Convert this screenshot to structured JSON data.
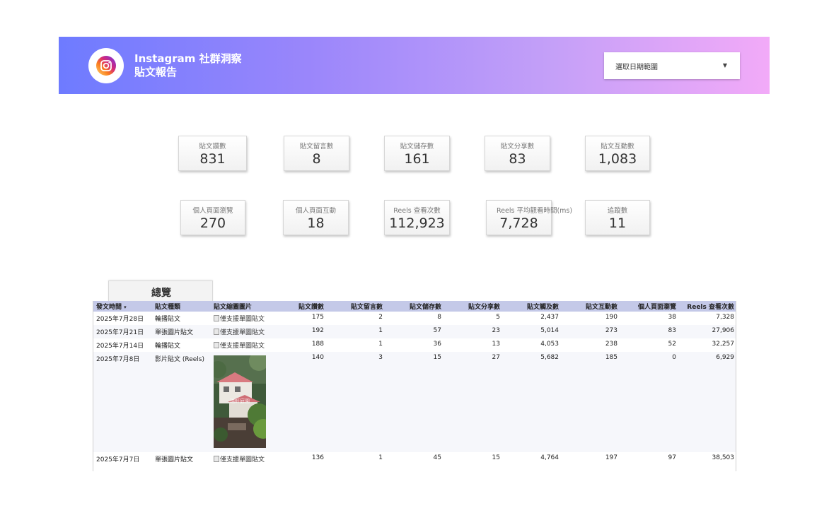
{
  "header": {
    "title_line1": "Instagram 社群洞察",
    "title_line2": "貼文報告",
    "logo_icon": "instagram-icon",
    "date_selector": {
      "label": "選取日期範圍",
      "icon": "dropdown-caret-icon"
    }
  },
  "metrics_row1": [
    {
      "label": "貼文讚數",
      "value": "831"
    },
    {
      "label": "貼文留言數",
      "value": "8"
    },
    {
      "label": "貼文儲存數",
      "value": "161"
    },
    {
      "label": "貼文分享數",
      "value": "83"
    },
    {
      "label": "貼文互動數",
      "value": "1,083"
    }
  ],
  "metrics_row2": [
    {
      "label": "個人頁面瀏覽",
      "value": "270"
    },
    {
      "label": "個人頁面互動",
      "value": "18"
    },
    {
      "label": "Reels 查看次數",
      "value": "112,923"
    },
    {
      "label": "Reels 平均觀看時間(ms)",
      "value": "7,728"
    },
    {
      "label": "追蹤數",
      "value": "11"
    }
  ],
  "tab": {
    "label": "總覽"
  },
  "table": {
    "sort_indicator": "▾",
    "headers": [
      "發文時間",
      "貼文種類",
      "貼文縮圖圖片",
      "貼文讚數",
      "貼文留言數",
      "貼文儲存數",
      "貼文分享數",
      "貼文觸及數",
      "貼文互動數",
      "個人頁面瀏覽",
      "Reels 查看次數"
    ],
    "rows": [
      {
        "date": "2025年7月28日",
        "type": "輪播貼文",
        "thumb": "僅支援單圖貼文",
        "likes": "175",
        "comments": "2",
        "saves": "8",
        "shares": "5",
        "reach": "2,437",
        "interactions": "190",
        "profile_views": "38",
        "reels_views": "7,328"
      },
      {
        "date": "2025年7月21日",
        "type": "單張圖片貼文",
        "thumb": "僅支援單圖貼文",
        "likes": "192",
        "comments": "1",
        "saves": "57",
        "shares": "23",
        "reach": "5,014",
        "interactions": "273",
        "profile_views": "83",
        "reels_views": "27,906"
      },
      {
        "date": "2025年7月14日",
        "type": "輪播貼文",
        "thumb": "僅支援單圖貼文",
        "likes": "188",
        "comments": "1",
        "saves": "36",
        "shares": "13",
        "reach": "4,053",
        "interactions": "238",
        "profile_views": "52",
        "reels_views": "32,257"
      },
      {
        "date": "2025年7月8日",
        "type": "影片貼文 (Reels)",
        "thumb": "",
        "thumb_caption": "瑞軒庭園",
        "likes": "140",
        "comments": "3",
        "saves": "15",
        "shares": "27",
        "reach": "5,682",
        "interactions": "185",
        "profile_views": "0",
        "reels_views": "6,929"
      },
      {
        "date": "2025年7月7日",
        "type": "單張圖片貼文",
        "thumb": "僅支援單圖貼文",
        "likes": "136",
        "comments": "1",
        "saves": "45",
        "shares": "15",
        "reach": "4,764",
        "interactions": "197",
        "profile_views": "97",
        "reels_views": "38,503"
      }
    ]
  }
}
